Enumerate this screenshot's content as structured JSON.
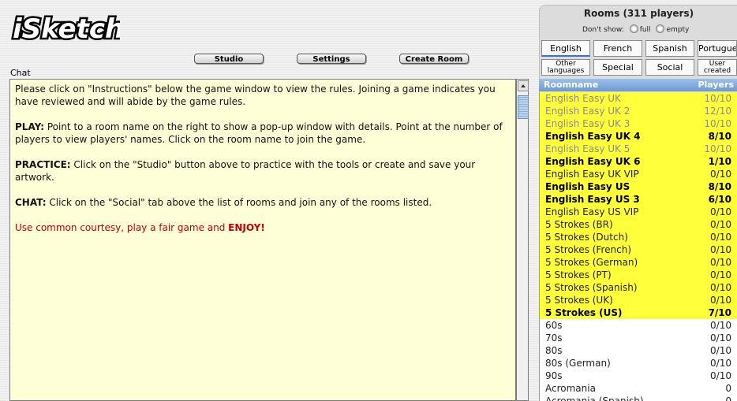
{
  "logo": {
    "text": "iSketch"
  },
  "toolbar": {
    "studio": "Studio",
    "settings": "Settings",
    "create_room": "Create Room"
  },
  "chat": {
    "label": "Chat",
    "intro": " Please click on \"Instructions\" below the game window to view the rules. Joining a game indicates you have reviewed and will abide by the game rules.",
    "play_head": "PLAY:",
    "play_text": " Point to a room name on the right to show a pop-up window with details. Point at the number of players to view players' names. Click on the room name to join the game.",
    "practice_head": "PRACTICE:",
    "practice_text": " Click on the \"Studio\" button above to practice with the tools or create and save your artwork.",
    "chat_head": "CHAT:",
    "chat_text": " Click on the \"Social\" tab above the list of rooms and join any of the rooms listed.",
    "courtesy": "Use common courtesy, play a fair game and ",
    "enjoy": "ENJOY!"
  },
  "rooms_panel": {
    "title": "Rooms (311 players)",
    "dont_show": "Don't show:",
    "full": "full",
    "empty": "empty",
    "tabs_row1": [
      "English",
      "French",
      "Spanish",
      "Portugues"
    ],
    "tabs_row2": [
      "Other languages",
      "Special",
      "Social",
      "User created"
    ],
    "col_name": "Roomname",
    "col_players": "Players"
  },
  "rooms": [
    {
      "name": "English Easy UK",
      "players": "10/10",
      "style": "full",
      "hl": true
    },
    {
      "name": "English Easy UK 2",
      "players": "12/10",
      "style": "full",
      "hl": true
    },
    {
      "name": "English Easy UK 3",
      "players": "10/10",
      "style": "full",
      "hl": true
    },
    {
      "name": "English Easy UK 4",
      "players": "8/10",
      "style": "bold",
      "hl": true
    },
    {
      "name": "English Easy UK 5",
      "players": "10/10",
      "style": "full",
      "hl": true
    },
    {
      "name": "English Easy UK 6",
      "players": "1/10",
      "style": "bold",
      "hl": true
    },
    {
      "name": "English Easy UK VIP",
      "players": "0/10",
      "style": "normal",
      "hl": true
    },
    {
      "name": "English Easy US",
      "players": "8/10",
      "style": "bold",
      "hl": true
    },
    {
      "name": "English Easy US 3",
      "players": "6/10",
      "style": "bold",
      "hl": true
    },
    {
      "name": "English Easy US VIP",
      "players": "0/10",
      "style": "normal",
      "hl": true
    },
    {
      "name": "5 Strokes (BR)",
      "players": "0/10",
      "style": "normal",
      "hl": true
    },
    {
      "name": "5 Strokes (Dutch)",
      "players": "0/10",
      "style": "normal",
      "hl": true
    },
    {
      "name": "5 Strokes (French)",
      "players": "0/10",
      "style": "normal",
      "hl": true
    },
    {
      "name": "5 Strokes (German)",
      "players": "0/10",
      "style": "normal",
      "hl": true
    },
    {
      "name": "5 Strokes (PT)",
      "players": "0/10",
      "style": "normal",
      "hl": true
    },
    {
      "name": "5 Strokes (Spanish)",
      "players": "0/10",
      "style": "normal",
      "hl": true
    },
    {
      "name": "5 Strokes (UK)",
      "players": "0/10",
      "style": "normal",
      "hl": true
    },
    {
      "name": "5 Strokes (US)",
      "players": "7/10",
      "style": "bold",
      "hl": true
    },
    {
      "name": "60s",
      "players": "0/10",
      "style": "normal",
      "hl": false
    },
    {
      "name": "70s",
      "players": "0/10",
      "style": "normal",
      "hl": false
    },
    {
      "name": "80s",
      "players": "0/10",
      "style": "normal",
      "hl": false
    },
    {
      "name": "80s (German)",
      "players": "0/10",
      "style": "normal",
      "hl": false
    },
    {
      "name": "90s",
      "players": "0/10",
      "style": "normal",
      "hl": false
    },
    {
      "name": "Acromania",
      "players": "0",
      "style": "normal",
      "hl": false
    },
    {
      "name": "Acromania (Spanish)",
      "players": "0",
      "style": "normal",
      "hl": false
    }
  ]
}
